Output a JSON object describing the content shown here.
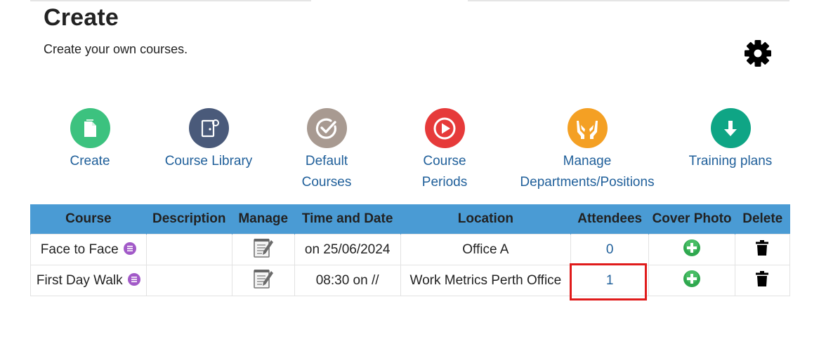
{
  "header": {
    "title": "Create",
    "subtitle": "Create your own courses."
  },
  "tiles": [
    {
      "label": "Create",
      "icon": "document-icon",
      "color": "#3cc27f"
    },
    {
      "label": "Course Library",
      "icon": "door-icon",
      "color": "#4a5a7a"
    },
    {
      "label": "Default Courses",
      "icon": "check-circle-icon",
      "color": "#a89a91"
    },
    {
      "label": "Course Periods",
      "icon": "play-circle-icon",
      "color": "#e63a3a"
    },
    {
      "label": "Manage Departments/Positions",
      "icon": "hands-icon",
      "color": "#f4a024"
    },
    {
      "label": "Training plans",
      "icon": "download-arrow-icon",
      "color": "#0fa585"
    }
  ],
  "table": {
    "headers": [
      "Course",
      "Description",
      "Manage",
      "Time and Date",
      "Location",
      "Attendees",
      "Cover Photo",
      "Delete"
    ],
    "rows": [
      {
        "course": "Face to Face",
        "description": "",
        "time_date": "on 25/06/2024",
        "location": "Office A",
        "attendees": "0"
      },
      {
        "course": "First Day Walk",
        "description": "",
        "time_date": "08:30 on //",
        "location": "Work Metrics Perth Office",
        "attendees": "1"
      }
    ]
  },
  "colors": {
    "header_bg": "#4a9bd4",
    "link": "#1f5f9a",
    "info_dot": "#a25ac8",
    "add_photo": "#2fa84f",
    "highlight": "#e01b1b"
  }
}
